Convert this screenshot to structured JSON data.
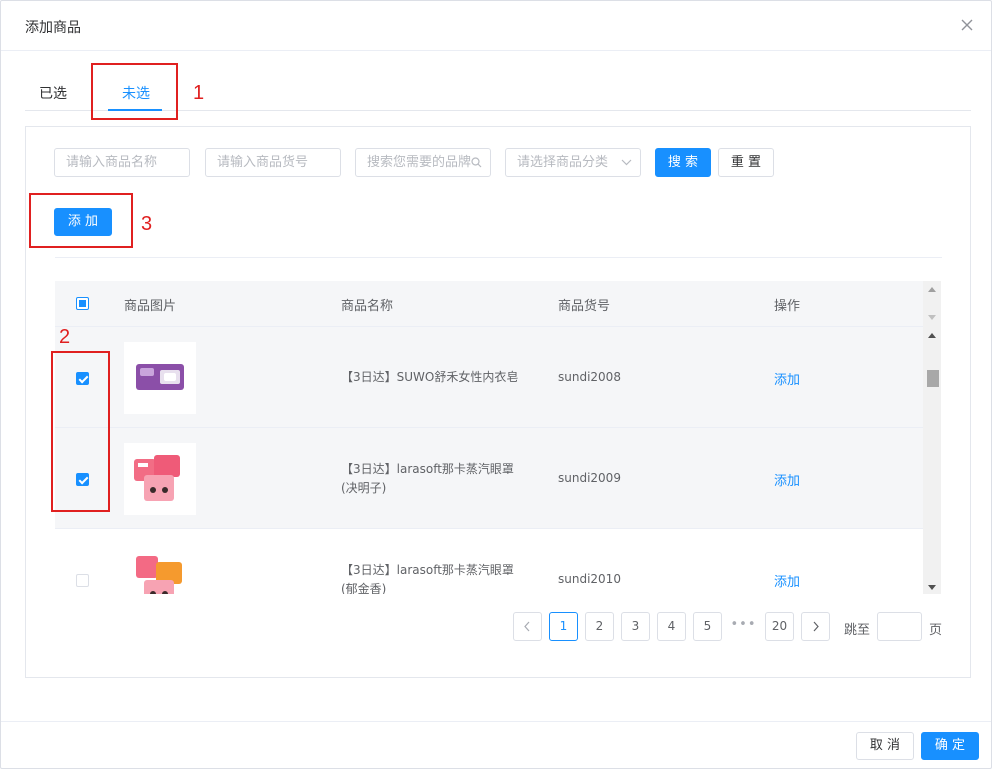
{
  "dialog": {
    "title": "添加商品"
  },
  "tabs": [
    {
      "label": "已选"
    },
    {
      "label": "未选"
    }
  ],
  "annotations": {
    "n1": "1",
    "n2": "2",
    "n3": "3"
  },
  "filters": {
    "name_placeholder": "请输入商品名称",
    "code_placeholder": "请输入商品货号",
    "brand_placeholder": "搜索您需要的品牌",
    "category_placeholder": "请选择商品分类",
    "search_label": "搜 索",
    "reset_label": "重 置"
  },
  "add_button_label": "添 加",
  "table": {
    "headers": {
      "image": "商品图片",
      "name": "商品名称",
      "code": "商品货号",
      "action": "操作"
    },
    "rows": [
      {
        "name_line1": "【3日达】SUWO舒禾女性内衣皂",
        "name_line2": "",
        "code": "sundi2008",
        "action": "添加",
        "checked": true
      },
      {
        "name_line1": "【3日达】larasoft那卡蒸汽眼罩",
        "name_line2": "(决明子)",
        "code": "sundi2009",
        "action": "添加",
        "checked": true
      },
      {
        "name_line1": "【3日达】larasoft那卡蒸汽眼罩",
        "name_line2": "(郁金香)",
        "code": "sundi2010",
        "action": "添加",
        "checked": false
      }
    ]
  },
  "pagination": {
    "pages": [
      "1",
      "2",
      "3",
      "4",
      "5"
    ],
    "ellipsis": "•••",
    "last_page": "20",
    "current": "1",
    "jump_prefix": "跳至",
    "jump_suffix": "页"
  },
  "footer": {
    "cancel_label": "取 消",
    "confirm_label": "确 定"
  },
  "colors": {
    "primary": "#1890ff",
    "annotation": "#e02020"
  }
}
